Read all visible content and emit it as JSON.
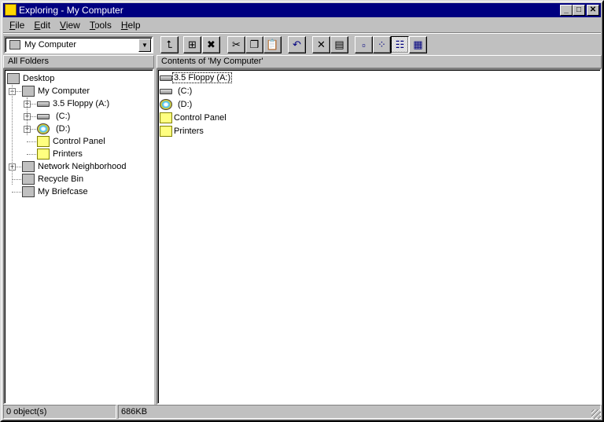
{
  "window": {
    "title": "Exploring - My Computer",
    "minimize": "_",
    "maximize": "□",
    "close": "✕"
  },
  "menu": [
    "File",
    "Edit",
    "View",
    "Tools",
    "Help"
  ],
  "menu_accel": [
    "F",
    "E",
    "V",
    "T",
    "H"
  ],
  "address": {
    "value": "My Computer",
    "dropdown": "▼"
  },
  "toolbar": [
    {
      "name": "up-one-level",
      "glyph": "⮤"
    },
    {
      "name": "map-network-drive",
      "glyph": "⊞"
    },
    {
      "name": "disconnect-network-drive",
      "glyph": "✖"
    },
    {
      "name": "cut",
      "glyph": "✂"
    },
    {
      "name": "copy",
      "glyph": "❐"
    },
    {
      "name": "paste",
      "glyph": "📋"
    },
    {
      "name": "undo",
      "glyph": "↶"
    },
    {
      "name": "delete",
      "glyph": "✕"
    },
    {
      "name": "properties",
      "glyph": "▤"
    },
    {
      "name": "large-icons",
      "glyph": "▫"
    },
    {
      "name": "small-icons",
      "glyph": "⁘"
    },
    {
      "name": "list",
      "glyph": "☷",
      "pressed": true
    },
    {
      "name": "details",
      "glyph": "▦"
    }
  ],
  "left_header": "All Folders",
  "right_header": "Contents of 'My Computer'",
  "tree": [
    {
      "label": "Desktop",
      "level": 0
    },
    {
      "label": "My Computer",
      "level": 1,
      "expander": "−"
    },
    {
      "label": "3.5 Floppy (A:)",
      "level": 2,
      "expander": "+"
    },
    {
      "label": "(C:)",
      "level": 2,
      "expander": "+"
    },
    {
      "label": "(D:)",
      "level": 2,
      "expander": "+"
    },
    {
      "label": "Control Panel",
      "level": 2
    },
    {
      "label": "Printers",
      "level": 2
    },
    {
      "label": "Network Neighborhood",
      "level": 1,
      "expander": "+"
    },
    {
      "label": "Recycle Bin",
      "level": 1
    },
    {
      "label": "My Briefcase",
      "level": 1
    }
  ],
  "contents": [
    {
      "label": "3.5 Floppy (A:)",
      "icon": "floppy",
      "selected": true
    },
    {
      "label": "(C:)",
      "icon": "drive"
    },
    {
      "label": "(D:)",
      "icon": "cdrom"
    },
    {
      "label": "Control Panel",
      "icon": "folder"
    },
    {
      "label": "Printers",
      "icon": "folder"
    }
  ],
  "status": {
    "objects": "0 object(s)",
    "size": "686KB"
  }
}
